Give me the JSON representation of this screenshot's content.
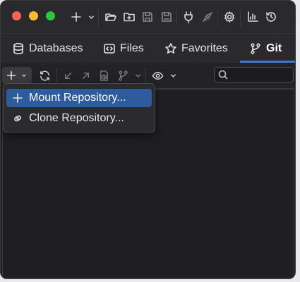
{
  "toolbar": {
    "icons": [
      "add-icon",
      "chevron-down-icon",
      "open-folder-icon",
      "open-folder-icon",
      "save-icon",
      "save-as-icon",
      "plug-icon",
      "disconnect-icon",
      "gear-icon",
      "chart-icon",
      "history-icon"
    ]
  },
  "tabs": [
    {
      "label": "Databases",
      "icon": "database-icon"
    },
    {
      "label": "Files",
      "icon": "file-code-icon"
    },
    {
      "label": "Favorites",
      "icon": "star-icon"
    },
    {
      "label": "Git",
      "icon": "branch-icon",
      "active": true
    }
  ],
  "subtoolbar": {
    "search_value": ""
  },
  "menu": {
    "items": [
      {
        "label": "Mount Repository...",
        "icon": "plus-icon",
        "selected": true
      },
      {
        "label": "Clone Repository...",
        "icon": "link-icon",
        "selected": false
      }
    ]
  },
  "colors": {
    "accent": "#3a7bd5",
    "menu_selected": "#2d5b9b",
    "background": "#1f1f21"
  }
}
